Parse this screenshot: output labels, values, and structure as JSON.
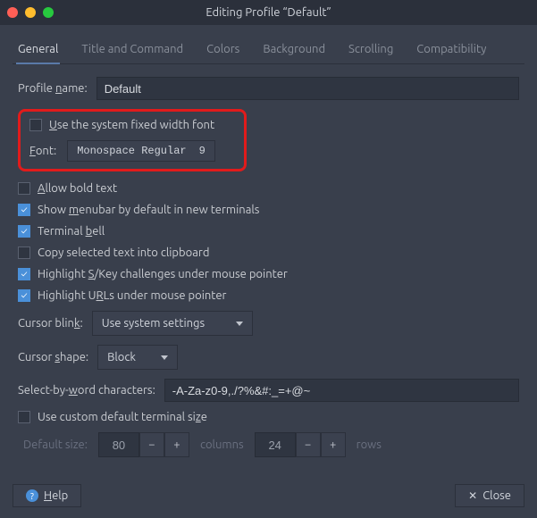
{
  "window": {
    "title": "Editing Profile “Default”"
  },
  "tabs": {
    "general": "General",
    "title_cmd": "Title and Command",
    "colors": "Colors",
    "background": "Background",
    "scrolling": "Scrolling",
    "compat": "Compatibility"
  },
  "profile_name": {
    "label": "Profile name:",
    "value": "Default"
  },
  "use_system_font": "Use the system fixed width font",
  "font": {
    "label": "Font:",
    "name": "Monospace Regular",
    "size": "9"
  },
  "allow_bold": "Allow bold text",
  "show_menubar": "Show menubar by default in new terminals",
  "terminal_bell": "Terminal bell",
  "copy_clipboard": "Copy selected text into clipboard",
  "highlight_skey": "Highlight S/Key challenges under mouse pointer",
  "highlight_urls": "Highlight URLs under mouse pointer",
  "cursor_blink": {
    "label": "Cursor blink:",
    "value": "Use system settings"
  },
  "cursor_shape": {
    "label": "Cursor shape:",
    "value": "Block"
  },
  "select_word": {
    "label": "Select-by-word characters:",
    "value": "-A-Za-z0-9,./?%&#:_=+@~"
  },
  "custom_size": "Use custom default terminal size",
  "default_size": {
    "label": "Default size:",
    "cols": "80",
    "cols_label": "columns",
    "rows": "24",
    "rows_label": "rows"
  },
  "buttons": {
    "help": "Help",
    "close": "Close"
  }
}
